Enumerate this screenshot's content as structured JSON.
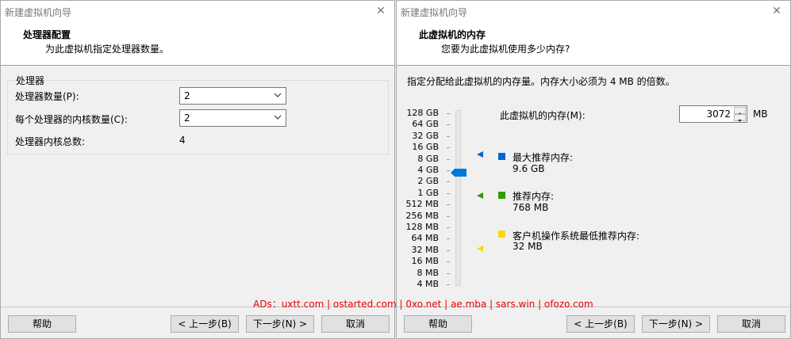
{
  "left": {
    "window_title": "新建虚拟机向导",
    "header_title": "处理器配置",
    "header_subtitle": "为此虚拟机指定处理器数量。",
    "group_label": "处理器",
    "processor_count_label": "处理器数量(P):",
    "processor_count_value": "2",
    "cores_per_processor_label": "每个处理器的内核数量(C):",
    "cores_per_processor_value": "2",
    "total_cores_label": "处理器内核总数:",
    "total_cores_value": "4",
    "buttons": {
      "help": "帮助",
      "back": "< 上一步(B)",
      "next": "下一步(N) >",
      "cancel": "取消"
    }
  },
  "right": {
    "window_title": "新建虚拟机向导",
    "header_title": "此虚拟机的内存",
    "header_subtitle": "您要为此虚拟机使用多少内存?",
    "intro": "指定分配给此虚拟机的内存量。内存大小必须为 4 MB 的倍数。",
    "memory_label": "此虚拟机的内存(M):",
    "memory_value": "3072",
    "memory_unit": "MB",
    "scale": [
      "128 GB",
      "64 GB",
      "32 GB",
      "16 GB",
      "8 GB",
      "4 GB",
      "2 GB",
      "1 GB",
      "512 MB",
      "256 MB",
      "128 MB",
      "64 MB",
      "32 MB",
      "16 MB",
      "8 MB",
      "4 MB"
    ],
    "max_recommended_label": "最大推荐内存:",
    "max_recommended_value": "9.6 GB",
    "recommended_label": "推荐内存:",
    "recommended_value": "768 MB",
    "guest_min_label": "客户机操作系统最低推荐内存:",
    "guest_min_value": "32 MB",
    "colors": {
      "max": "#0066cc",
      "recommended": "#339900",
      "guest_min": "#ffd700",
      "thumb": "#0078d7"
    },
    "buttons": {
      "help": "帮助",
      "back": "< 上一步(B)",
      "next": "下一步(N) >",
      "cancel": "取消"
    }
  },
  "ads_text": "ADs：uxtt.com | ostarted.com | 0xo.net | ae.mba | sars.win | ofozo.com"
}
